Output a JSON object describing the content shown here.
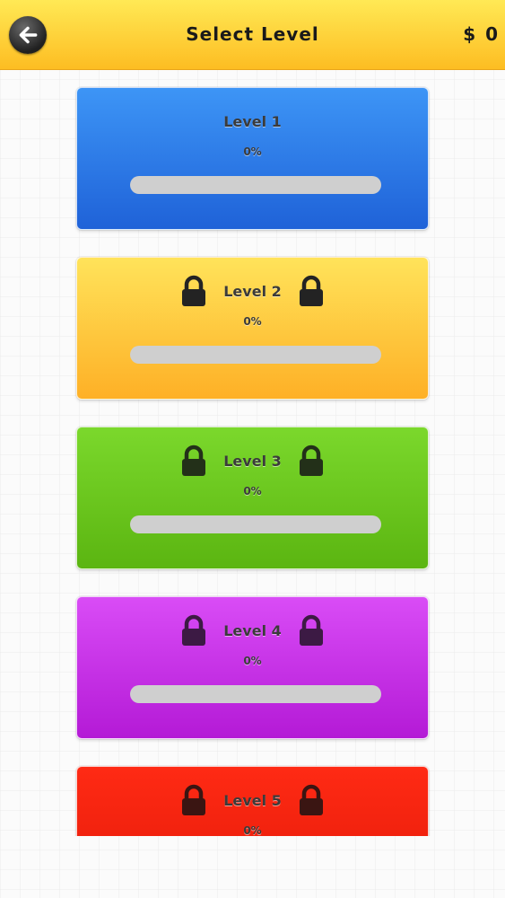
{
  "header": {
    "title": "Select Level",
    "coins": "$ 0",
    "back_icon": "arrow-left-icon"
  },
  "levels": [
    {
      "name": "Level 1",
      "progress_text": "0%",
      "progress": 0,
      "locked": false,
      "color_top": "#3d95f6",
      "color_bottom": "#1f62d8",
      "lock_color": "#232323"
    },
    {
      "name": "Level 2",
      "progress_text": "0%",
      "progress": 0,
      "locked": true,
      "color_top": "#ffe35a",
      "color_bottom": "#feb026",
      "lock_color": "#232323"
    },
    {
      "name": "Level 3",
      "progress_text": "0%",
      "progress": 0,
      "locked": true,
      "color_top": "#7bd82c",
      "color_bottom": "#5bb511",
      "lock_color": "#233019"
    },
    {
      "name": "Level 4",
      "progress_text": "0%",
      "progress": 0,
      "locked": true,
      "color_top": "#d94cf6",
      "color_bottom": "#b41ad6",
      "lock_color": "#3c1a44"
    },
    {
      "name": "Level 5",
      "progress_text": "0%",
      "progress": 0,
      "locked": true,
      "color_top": "#ff2a14",
      "color_bottom": "#e31a08",
      "lock_color": "#3a1512"
    }
  ]
}
